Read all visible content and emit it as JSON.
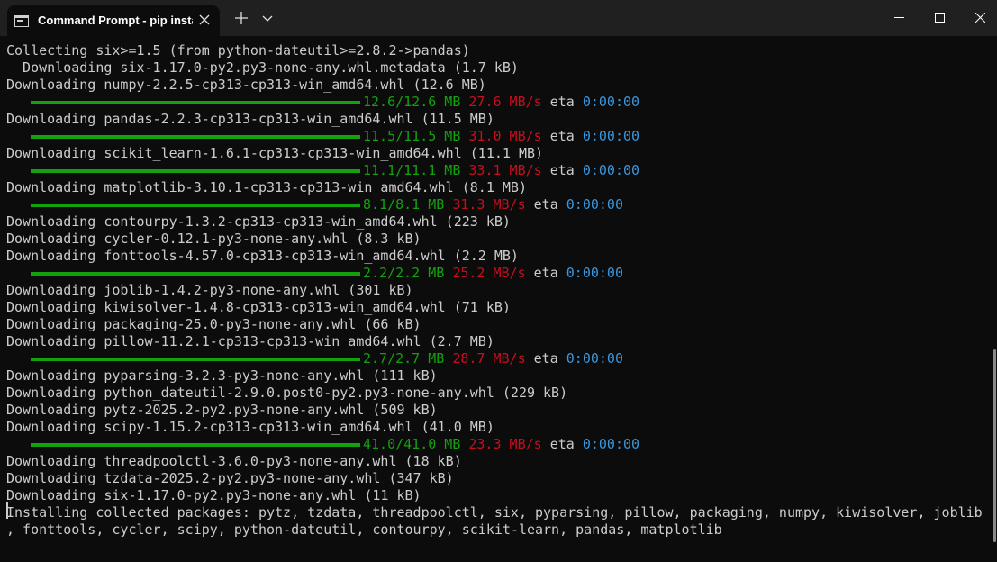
{
  "window": {
    "tab_title": "Command Prompt - pip  insta"
  },
  "icons": {
    "tab": "cmd-icon",
    "close_tab": "close-icon",
    "new_tab": "plus-icon",
    "dropdown": "chevron-down-icon",
    "minimize": "minimize-icon",
    "maximize": "maximize-icon",
    "close_window": "close-icon"
  },
  "colors": {
    "background": "#0c0c0c",
    "titlebar": "#202020",
    "text": "#cccccc",
    "progress_green": "#13a10e",
    "speed_red": "#c50f1f",
    "eta_blue": "#3a96dd"
  },
  "terminal": {
    "lines": [
      "Collecting six>=1.5 (from python-dateutil>=2.8.2->pandas)",
      "  Downloading six-1.17.0-py2.py3-none-any.whl.metadata (1.7 kB)",
      "Downloading numpy-2.2.5-cp313-cp313-win_amd64.whl (12.6 MB)",
      "",
      "Downloading pandas-2.2.3-cp313-cp313-win_amd64.whl (11.5 MB)",
      "",
      "Downloading scikit_learn-1.6.1-cp313-cp313-win_amd64.whl (11.1 MB)",
      "",
      "Downloading matplotlib-3.10.1-cp313-cp313-win_amd64.whl (8.1 MB)",
      "",
      "Downloading contourpy-1.3.2-cp313-cp313-win_amd64.whl (223 kB)",
      "Downloading cycler-0.12.1-py3-none-any.whl (8.3 kB)",
      "Downloading fonttools-4.57.0-cp313-cp313-win_amd64.whl (2.2 MB)",
      "",
      "Downloading joblib-1.4.2-py3-none-any.whl (301 kB)",
      "Downloading kiwisolver-1.4.8-cp313-cp313-win_amd64.whl (71 kB)",
      "Downloading packaging-25.0-py3-none-any.whl (66 kB)",
      "Downloading pillow-11.2.1-cp313-cp313-win_amd64.whl (2.7 MB)",
      "",
      "Downloading pyparsing-3.2.3-py3-none-any.whl (111 kB)",
      "Downloading python_dateutil-2.9.0.post0-py2.py3-none-any.whl (229 kB)",
      "Downloading pytz-2025.2-py2.py3-none-any.whl (509 kB)",
      "Downloading scipy-1.15.2-cp313-cp313-win_amd64.whl (41.0 MB)",
      "",
      "Downloading threadpoolctl-3.6.0-py3-none-any.whl (18 kB)",
      "Downloading tzdata-2025.2-py2.py3-none-any.whl (347 kB)",
      "Downloading six-1.17.0-py2.py3-none-any.whl (11 kB)",
      "Installing collected packages: pytz, tzdata, threadpoolctl, six, pyparsing, pillow, packaging, numpy, kiwisolver, joblib",
      ", fonttools, cycler, scipy, python-dateutil, contourpy, scikit-learn, pandas, matplotlib"
    ],
    "progress": [
      {
        "size": "12.6/12.6 MB",
        "speed": "27.6 MB/s",
        "eta_label": "eta",
        "eta": "0:00:00",
        "fraction": 1.0
      },
      {
        "size": "11.5/11.5 MB",
        "speed": "31.0 MB/s",
        "eta_label": "eta",
        "eta": "0:00:00",
        "fraction": 1.0
      },
      {
        "size": "11.1/11.1 MB",
        "speed": "33.1 MB/s",
        "eta_label": "eta",
        "eta": "0:00:00",
        "fraction": 1.0
      },
      {
        "size": "8.1/8.1 MB",
        "speed": "31.3 MB/s",
        "eta_label": "eta",
        "eta": "0:00:00",
        "fraction": 1.0
      },
      {
        "size": "2.2/2.2 MB",
        "speed": "25.2 MB/s",
        "eta_label": "eta",
        "eta": "0:00:00",
        "fraction": 1.0
      },
      {
        "size": "2.7/2.7 MB",
        "speed": "28.7 MB/s",
        "eta_label": "eta",
        "eta": "0:00:00",
        "fraction": 1.0
      },
      {
        "size": "41.0/41.0 MB",
        "speed": "23.3 MB/s",
        "eta_label": "eta",
        "eta": "0:00:00",
        "fraction": 1.0
      }
    ]
  }
}
